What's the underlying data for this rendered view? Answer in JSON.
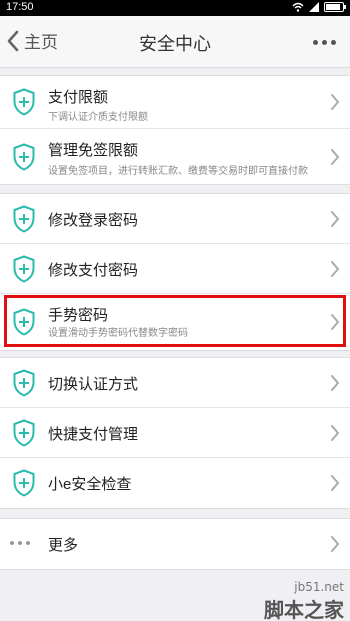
{
  "status_bar": {
    "time": "17:50"
  },
  "nav": {
    "back_label": "主页",
    "title": "安全中心"
  },
  "groups": [
    [
      {
        "label": "支付限额",
        "sub": "下调认证介质支付限额"
      },
      {
        "label": "管理免签限额",
        "sub": "设置免签项目，进行转账汇款、缴费等交易时即可直接付款"
      }
    ],
    [
      {
        "label": "修改登录密码"
      },
      {
        "label": "修改支付密码"
      },
      {
        "label": "手势密码",
        "sub": "设置滑动手势密码代替数字密码"
      }
    ],
    [
      {
        "label": "切换认证方式"
      },
      {
        "label": "快捷支付管理"
      },
      {
        "label": "小e安全检查"
      }
    ],
    [
      {
        "label": "更多"
      }
    ]
  ],
  "watermark": {
    "line1": "jb51.net",
    "line2": "脚本之家"
  },
  "colors": {
    "shield": "#2bbbad",
    "highlight": "#e01010"
  }
}
